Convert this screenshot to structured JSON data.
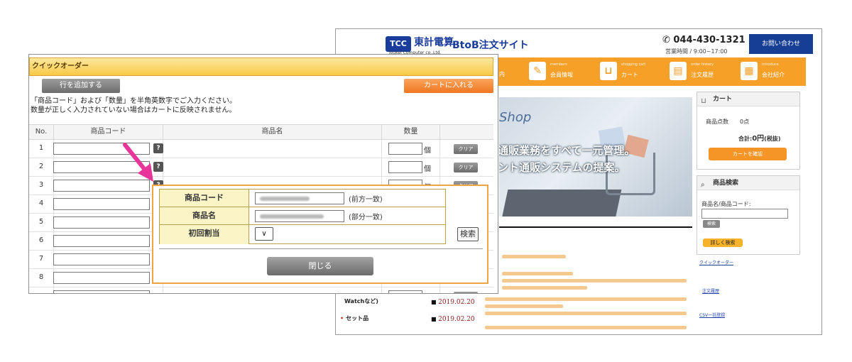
{
  "site": {
    "logo_text": "東計電算",
    "logo_mark": "TCC",
    "logo_sub": "Toukei Computer co.,Ltd.",
    "title": "BtoB注文サイト",
    "phone": "044-430-1321",
    "hours": "営業時間 / 9:00~17:00",
    "contact_button": "お問い合わせ",
    "nav_left_label": "内",
    "nav": [
      {
        "en": "members",
        "jp": "会員情報",
        "icon": "pencil-icon"
      },
      {
        "en": "shopping cart",
        "jp": "カート",
        "icon": "cart-icon"
      },
      {
        "en": "order history",
        "jp": "注文履歴",
        "icon": "book-icon"
      },
      {
        "en": "introduce",
        "jp": "会社紹介",
        "icon": "document-icon"
      }
    ],
    "hero": {
      "shop": "Shop",
      "line1": "通販業務をすべて一元管理。",
      "line2": "ント通販システムの提案。"
    },
    "categories": {
      "watch": "Watchなど)",
      "set": "セット品"
    },
    "news_dates": [
      "2019.02.20",
      "2019.02.20"
    ],
    "cart": {
      "title": "カート",
      "count_label": "商品点数",
      "count_value": "0点",
      "total_label": "合計:",
      "total_value": "0円",
      "tax": "(税抜)",
      "confirm_button": "カートを確認"
    },
    "product_search": {
      "title": "商品検索",
      "field_label": "商品名/商品コード:",
      "search_button": "検索",
      "detail_button": "詳しく検索"
    },
    "links": {
      "quick_order": "クイックオーダー",
      "order_history": "注文履歴",
      "csv": "CSV一括登録"
    }
  },
  "quick_order": {
    "title": "クイックオーダー",
    "add_row_button": "行を追加する",
    "add_to_cart_button": "カートに入れる",
    "instruction_1": "「商品コード」および「数量」を半角英数字でご入力ください。",
    "instruction_2": "数量が正しく入力されていない場合はカートに反映されません。",
    "columns": [
      "No.",
      "商品コード",
      "商品名",
      "数量"
    ],
    "rows": [
      "1",
      "2",
      "3",
      "4",
      "5",
      "6",
      "7",
      "8"
    ],
    "unit": "個",
    "clear_button": "クリア",
    "help_icon": "?"
  },
  "search_popup": {
    "fields": [
      {
        "label": "商品コード",
        "hint": "(前方一致)"
      },
      {
        "label": "商品名",
        "hint": "(部分一致)"
      },
      {
        "label": "初回割当",
        "hint": ""
      }
    ],
    "select_arrow": "∨",
    "search_button": "検索",
    "close_button": "閉じる"
  },
  "colors": {
    "accent_orange": "#f7a028",
    "brand_blue": "#163e93",
    "title_yellow": "#f7c945",
    "arrow_pink": "#e8359a"
  }
}
